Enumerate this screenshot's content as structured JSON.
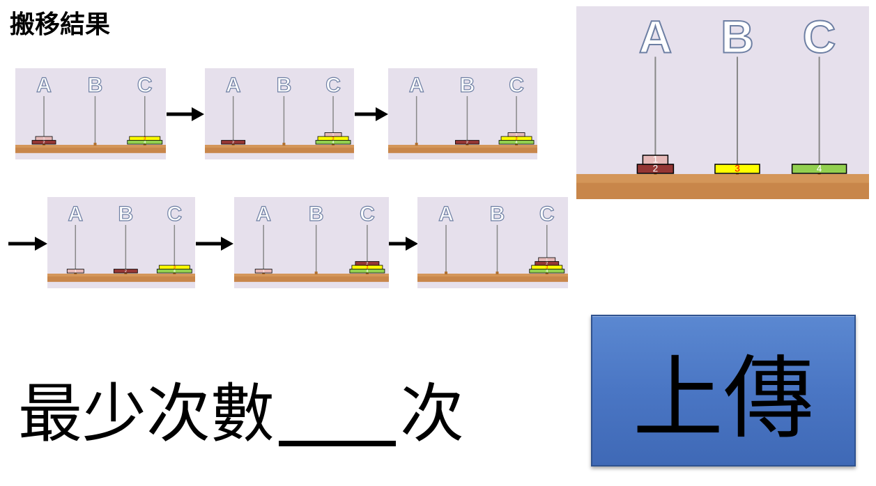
{
  "title": "搬移結果",
  "pegs": [
    "A",
    "B",
    "C"
  ],
  "steps": [
    {
      "A": [
        2,
        1
      ],
      "B": [],
      "C": [
        4,
        3
      ]
    },
    {
      "A": [
        2
      ],
      "B": [],
      "C": [
        4,
        3,
        1
      ]
    },
    {
      "A": [],
      "B": [
        2
      ],
      "C": [
        4,
        3,
        1
      ]
    },
    {
      "A": [
        1
      ],
      "B": [
        2
      ],
      "C": [
        4,
        3
      ]
    },
    {
      "A": [
        1
      ],
      "B": [],
      "C": [
        4,
        3,
        2
      ]
    },
    {
      "A": [],
      "B": [],
      "C": [
        4,
        3,
        2,
        1
      ]
    }
  ],
  "initial_state": {
    "A": [
      2,
      1
    ],
    "B": [
      3
    ],
    "C": [
      4
    ]
  },
  "disk_colors": {
    "1": "#e6b9b8",
    "2": "#943634",
    "3": "#ffff00",
    "4": "#92d050"
  },
  "disk_label_colors": {
    "1": "#ffffff",
    "2": "#ffffff",
    "3": "#ff0000",
    "4": "#ffffff"
  },
  "question": {
    "prefix": "最少次數",
    "suffix": "次"
  },
  "upload_button": {
    "label": "上傳"
  }
}
